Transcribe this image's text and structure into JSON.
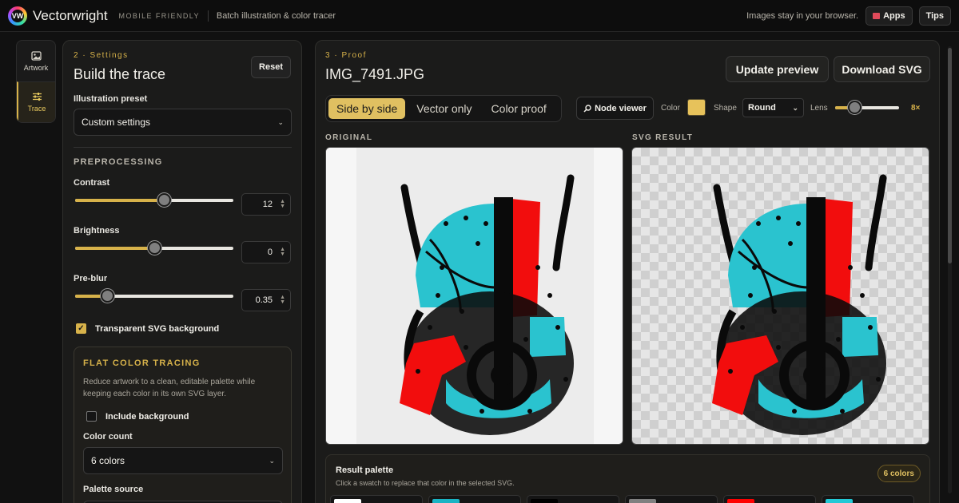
{
  "topbar": {
    "logo_mark": "VW",
    "app_name": "Vectorwright",
    "tag": "MOBILE FRIENDLY",
    "subtitle": "Batch illustration & color tracer",
    "privacy": "Images stay in your browser.",
    "apps_label": "Apps",
    "tips_label": "Tips"
  },
  "rail": {
    "items": [
      {
        "label": "Artwork",
        "icon": "image-icon",
        "active": false
      },
      {
        "label": "Trace",
        "icon": "sliders-icon",
        "active": true
      }
    ]
  },
  "settings": {
    "step": "2 · Settings",
    "title": "Build the trace",
    "reset_label": "Reset",
    "preset_label": "Illustration preset",
    "preset_value": "Custom settings",
    "preprocessing_caption": "PREPROCESSING",
    "contrast": {
      "label": "Contrast",
      "value": "12",
      "level": 0.56
    },
    "brightness": {
      "label": "Brightness",
      "value": "0",
      "level": 0.5
    },
    "preblur": {
      "label": "Pre-blur",
      "value": "0.35",
      "level": 0.2
    },
    "transparent_bg": {
      "label": "Transparent SVG background",
      "checked": true
    },
    "flat": {
      "title": "FLAT COLOR TRACING",
      "description": "Reduce artwork to a clean, editable palette while keeping each color in its own SVG layer.",
      "include_background": {
        "label": "Include background",
        "checked": false
      },
      "color_count_label": "Color count",
      "color_count_value": "6 colors",
      "palette_source_label": "Palette source"
    }
  },
  "proof": {
    "step": "3 · Proof",
    "file_name": "IMG_7491.JPG",
    "update_label": "Update preview",
    "download_label": "Download SVG",
    "views": [
      "Side by side",
      "Vector only",
      "Color proof"
    ],
    "active_view": 0,
    "node_viewer_label": "Node viewer",
    "color_label": "Color",
    "color_value": "#e7c25b",
    "shape_label": "Shape",
    "shape_value": "Round",
    "lens_label": "Lens",
    "lens_value": "8×",
    "lens_level": 0.3,
    "original_caption": "ORIGINAL",
    "result_caption": "SVG RESULT",
    "palette": {
      "title": "Result palette",
      "description": "Click a swatch to replace that color in the selected SVG.",
      "count_badge": "6 colors",
      "swatches": [
        "#ffffff",
        "#19b4c4",
        "#000000",
        "#808080",
        "#ff0000",
        "#22c9d6"
      ]
    }
  },
  "colors": {
    "accent": "#d7b24a",
    "cyan": "#2ac3cf",
    "red": "#f20d0d",
    "black": "#0a0a0a"
  }
}
